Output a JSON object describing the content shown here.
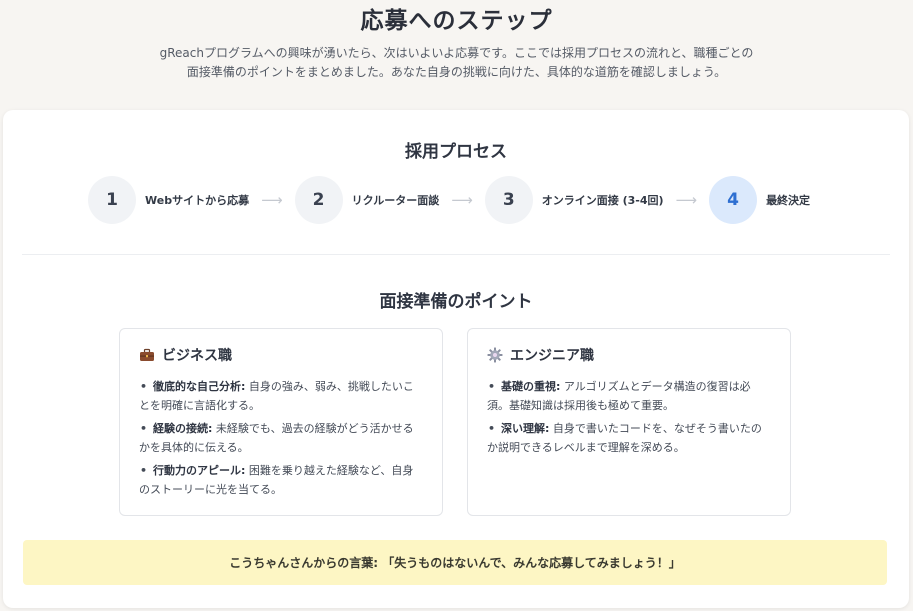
{
  "hero": {
    "title": "応募へのステップ",
    "description": "gReachプログラムへの興味が湧いたら、次はいよいよ応募です。ここでは採用プロセスの流れと、職種ごとの面接準備のポイントをまとめました。あなた自身の挑戦に向けた、具体的な道筋を確認しましょう。"
  },
  "process": {
    "title": "採用プロセス",
    "steps": [
      {
        "number": "1",
        "label": "Webサイトから応募"
      },
      {
        "number": "2",
        "label": "リクルーター面談"
      },
      {
        "number": "3",
        "label": "オンライン面接 (3-4回)"
      },
      {
        "number": "4",
        "label": "最終決定"
      }
    ],
    "arrow": "⟶",
    "active_step": 4
  },
  "tips": {
    "title": "面接準備のポイント",
    "business": {
      "icon": "briefcase-icon",
      "title": "ビジネス職",
      "items": [
        {
          "bold": "徹底的な自己分析:",
          "text": " 自身の強み、弱み、挑戦したいことを明確に言語化する。"
        },
        {
          "bold": "経験の接続:",
          "text": " 未経験でも、過去の経験がどう活かせるかを具体的に伝える。"
        },
        {
          "bold": "行動力のアピール:",
          "text": " 困難を乗り越えた経験など、自身のストーリーに光を当てる。"
        }
      ]
    },
    "engineer": {
      "icon": "gear-icon",
      "title": "エンジニア職",
      "items": [
        {
          "bold": "基礎の重視:",
          "text": " アルゴリズムとデータ構造の復習は必須。基礎知識は採用後も極めて重要。"
        },
        {
          "bold": "深い理解:",
          "text": " 自身で書いたコードを、なぜそう書いたのか説明できるレベルまで理解を深める。"
        }
      ]
    }
  },
  "quote": {
    "text": "こうちゃんさんからの言葉: 「失うものはないんで、みんな応募してみましょう！」"
  },
  "colors": {
    "active_step_bg": "#dbe9fc",
    "active_step_text": "#2e6fd1",
    "quote_bg": "#fdf6c4"
  }
}
